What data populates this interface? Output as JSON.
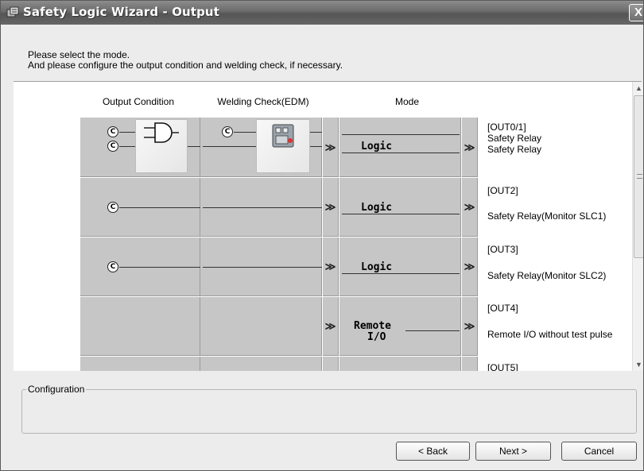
{
  "window": {
    "title": "Safety Logic Wizard - Output",
    "close_label": "X"
  },
  "header": {
    "line1": "Please select the mode.",
    "line2": "And please configure the output condition and welding check, if necessary."
  },
  "columns": {
    "output_condition": "Output Condition",
    "welding_check": "Welding Check(EDM)",
    "mode": "Mode"
  },
  "rows": [
    {
      "mode": "Logic",
      "out_id": "[OUT0/1]",
      "desc1": "Safety Relay",
      "desc2": "Safety Relay"
    },
    {
      "mode": "Logic",
      "out_id": "[OUT2]",
      "desc1": "Safety Relay(Monitor SLC1)"
    },
    {
      "mode": "Logic",
      "out_id": "[OUT3]",
      "desc1": "Safety Relay(Monitor SLC2)"
    },
    {
      "mode_line1": "Remote",
      "mode_line2": "I/O",
      "out_id": "[OUT4]",
      "desc1": "Remote I/O without test pulse"
    },
    {
      "out_id": "[OUT5]"
    }
  ],
  "symbols": {
    "c_mark": "C",
    "chevron": "≫"
  },
  "configuration": {
    "label": "Configuration"
  },
  "buttons": {
    "back": "< Back",
    "next": "Next >",
    "cancel": "Cancel"
  },
  "icons": {
    "app": "app-icon",
    "and_gate": "and-gate-icon",
    "relay": "relay-icon"
  }
}
